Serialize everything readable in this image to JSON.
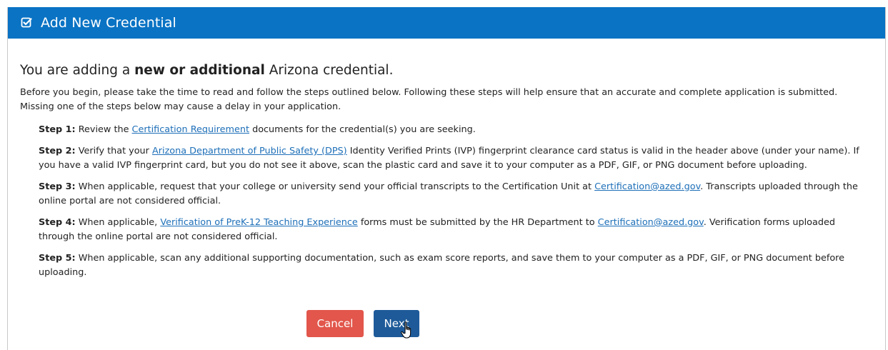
{
  "header": {
    "title": "Add New Credential",
    "icon": "check-square-icon"
  },
  "intro": {
    "heading_prefix": "You are adding a ",
    "heading_bold": "new or additional",
    "heading_suffix": " Arizona credential.",
    "paragraph": "Before you begin, please take the time to read and follow the steps outlined below. Following these steps will help ensure that an accurate and complete application is submitted. Missing one of the steps below may cause a delay in your application."
  },
  "steps": [
    {
      "label": "Step 1:",
      "before": " Review the ",
      "link": "Certification Requirement",
      "after": " documents for the credential(s) you are seeking."
    },
    {
      "label": "Step 2:",
      "before": " Verify that your ",
      "link": "Arizona Department of Public Safety (DPS)",
      "after": " Identity Verified Prints (IVP) fingerprint clearance card status is valid in the header above (under your name). If you have a valid IVP fingerprint card, but you do not see it above, scan the plastic card and save it to your computer as a PDF, GIF, or PNG document before uploading."
    },
    {
      "label": "Step 3:",
      "before": " When applicable, request that your college or university send your official transcripts to the Certification Unit at ",
      "link": "Certification@azed.gov",
      "after": ". Transcripts uploaded through the online portal are not considered official."
    },
    {
      "label": "Step 4:",
      "before": " When applicable, ",
      "link": "Verification of PreK-12 Teaching Experience",
      "middle": " forms must be submitted by the HR Department to ",
      "link2": "Certification@azed.gov",
      "after": ". Verification forms uploaded through the online portal are not considered official."
    },
    {
      "label": "Step 5:",
      "before": " When applicable, scan any additional supporting documentation, such as exam score reports, and save them to your computer as a PDF, GIF, or PNG document before uploading."
    }
  ],
  "buttons": {
    "cancel": "Cancel",
    "next": "Next"
  },
  "colors": {
    "header_bg": "#0a73c4",
    "cancel_bg": "#e2564b",
    "next_bg": "#1e5a99",
    "link": "#1d6fb8"
  }
}
